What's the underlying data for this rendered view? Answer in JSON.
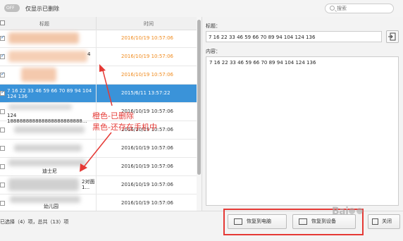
{
  "topbar": {
    "toggle_label": "OFF",
    "only_show_deleted": "仅显示已删除",
    "search_placeholder": "搜索"
  },
  "list": {
    "col_title": "标题",
    "col_time": "时间",
    "rows": [
      {
        "title": "",
        "time": "2016/10/19 10:57:06",
        "status": "deleted",
        "checked": true
      },
      {
        "title": "4",
        "time": "2016/10/19 10:57:06",
        "status": "deleted",
        "checked": true
      },
      {
        "title": "",
        "time": "2016/10/19 10:57:06",
        "status": "deleted",
        "checked": true
      },
      {
        "title": "7 16 22 33 46 59 66 70 89 94 104 124 136",
        "time": "2015/6/11 13:57:22",
        "status": "selected",
        "checked": true
      },
      {
        "title": "124 188888888888888888888888...",
        "time": "2016/10/19 10:57:06",
        "status": "kept",
        "checked": false
      },
      {
        "title": "",
        "time": "2016/10/19 10:57:06",
        "status": "kept",
        "checked": false
      },
      {
        "title": "",
        "time": "2016/10/19 10:57:06",
        "status": "kept",
        "checked": false
      },
      {
        "title": "迪士尼",
        "time": "2016/10/19 10:57:06",
        "status": "kept",
        "checked": false
      },
      {
        "title": "2对面 1...",
        "time": "2016/10/19 10:57:06",
        "status": "kept",
        "checked": false
      },
      {
        "title": "幼儿园",
        "time": "2016/10/19 10:57:06",
        "status": "kept",
        "checked": false
      }
    ]
  },
  "footer": {
    "selection_count": "已选择（4）项，总共（13）项"
  },
  "detail": {
    "title_label": "标题：",
    "title_value": "7  16 22 33 46 59 66  70  89  94  104  124  136",
    "content_label": "内容：",
    "content_value": "7 16 22 33 46 59 66 70 89 94 104 124 136"
  },
  "buttons": {
    "restore_to_pc": "恢复到电脑",
    "restore_to_device": "恢复到设备",
    "close": "关闭"
  },
  "annotations": {
    "line1": "橙色-已删除",
    "line2": "黑色-还存在手机中"
  },
  "colors": {
    "deleted": "#f08a1c",
    "kept": "#333333",
    "selected_row": "#3a93d9",
    "annotation": "#e53935"
  }
}
